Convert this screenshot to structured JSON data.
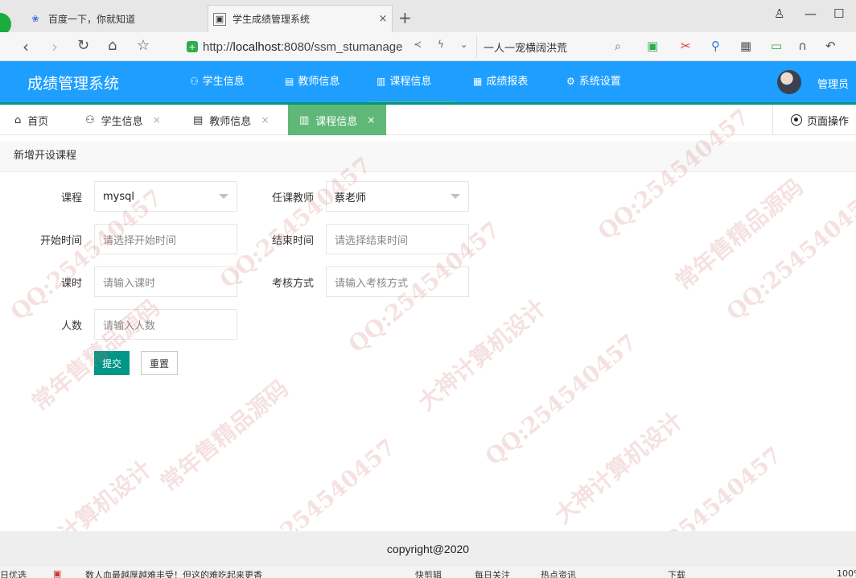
{
  "browser": {
    "tabs": [
      {
        "title": "百度一下，你就知道",
        "favicon": "paw-icon"
      },
      {
        "title": "学生成绩管理系统",
        "favicon": "page-icon",
        "close": "×"
      }
    ],
    "new_tab": "+",
    "address": {
      "url_prefix": "http://",
      "url_host": "localhost",
      "url_rest": ":8080/ssm_stumanage"
    },
    "search_text": "一人一宠横阔洪荒"
  },
  "app": {
    "title": "成绩管理系统",
    "menu": [
      {
        "label": "学生信息",
        "icon": "users-icon"
      },
      {
        "label": "教师信息",
        "icon": "doc-icon"
      },
      {
        "label": "课程信息",
        "icon": "book-icon"
      },
      {
        "label": "成绩报表",
        "icon": "table-icon"
      },
      {
        "label": "系统设置",
        "icon": "gear-icon"
      }
    ],
    "user": "管理员"
  },
  "page_tabs": [
    {
      "label": "首页",
      "icon": "home-icon"
    },
    {
      "label": "学生信息",
      "icon": "users-icon",
      "close": "×"
    },
    {
      "label": "教师信息",
      "icon": "doc-icon",
      "close": "×"
    },
    {
      "label": "课程信息",
      "icon": "book-icon",
      "close": "×"
    }
  ],
  "page_ops": "页面操作",
  "form": {
    "title": "新增开设课程",
    "course": {
      "label": "课程",
      "value": "mysql"
    },
    "teacher": {
      "label": "任课教师",
      "value": "蔡老师"
    },
    "start": {
      "label": "开始时间",
      "placeholder": "请选择开始时间"
    },
    "end": {
      "label": "结束时间",
      "placeholder": "请选择结束时间"
    },
    "hours": {
      "label": "课时",
      "placeholder": "请输入课时"
    },
    "exam": {
      "label": "考核方式",
      "placeholder": "请输入考核方式"
    },
    "people": {
      "label": "人数",
      "placeholder": "请输入人数"
    },
    "submit": "提交",
    "reset": "重置"
  },
  "footer": "copyright@2020",
  "statusbar": {
    "left": "日优选",
    "news": "数人血最越厚越难丰受！但这的难吃起来更香",
    "items": [
      "快剪辑",
      "每日关注",
      "热点资讯",
      "下载",
      "100%"
    ]
  },
  "watermark": {
    "qq": "QQ:254540457",
    "shop1": "常年售精品源码",
    "shop2": "大神计算机设计"
  },
  "colors": {
    "primary": "#1e9fff",
    "active_tab": "#5fb878",
    "button": "#009688"
  }
}
